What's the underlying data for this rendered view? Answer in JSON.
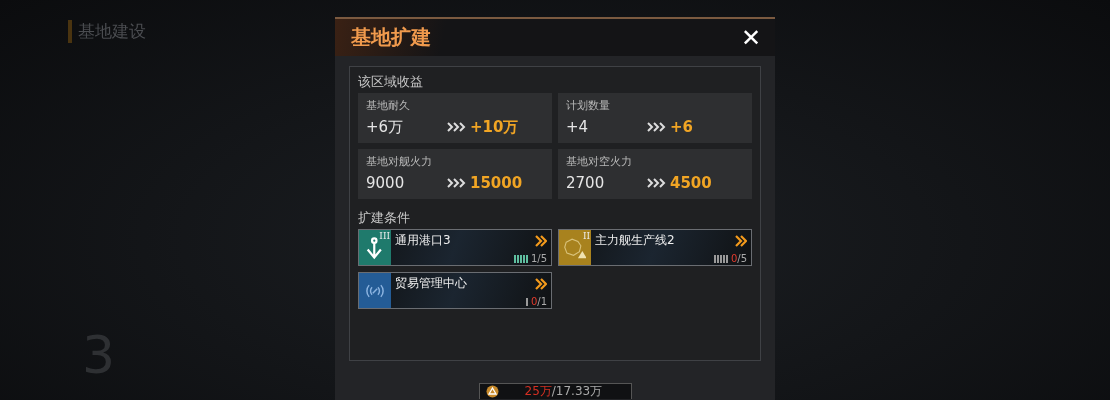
{
  "background": {
    "title": "基地建设",
    "level_number": "3"
  },
  "dialog": {
    "title": "基地扩建",
    "close": "✕",
    "yield_section": {
      "label": "该区域收益",
      "stats": [
        {
          "name": "基地耐久",
          "current": "+6万",
          "next": "+10万"
        },
        {
          "name": "计划数量",
          "current": "+4",
          "next": "+6"
        },
        {
          "name": "基地对舰火力",
          "current": "9000",
          "next": "15000"
        },
        {
          "name": "基地对空火力",
          "current": "2700",
          "next": "4500"
        }
      ]
    },
    "conditions_section": {
      "label": "扩建条件",
      "items": [
        {
          "kind": "anchor",
          "tier": "III",
          "name": "通用港口3",
          "current": "1",
          "total": "/5",
          "warning": false,
          "color": "#1f7a6c"
        },
        {
          "kind": "map",
          "tier": "II",
          "name": "主力舰生产线2",
          "current": "0",
          "total": "/5",
          "warning": true,
          "color": "#a8821e"
        },
        {
          "kind": "signal",
          "name": "贸易管理中心",
          "current": "0",
          "total": "/1",
          "warning": true,
          "color": "#245c96"
        }
      ]
    },
    "cost": {
      "required": "25万",
      "available": "/17.33万"
    }
  }
}
